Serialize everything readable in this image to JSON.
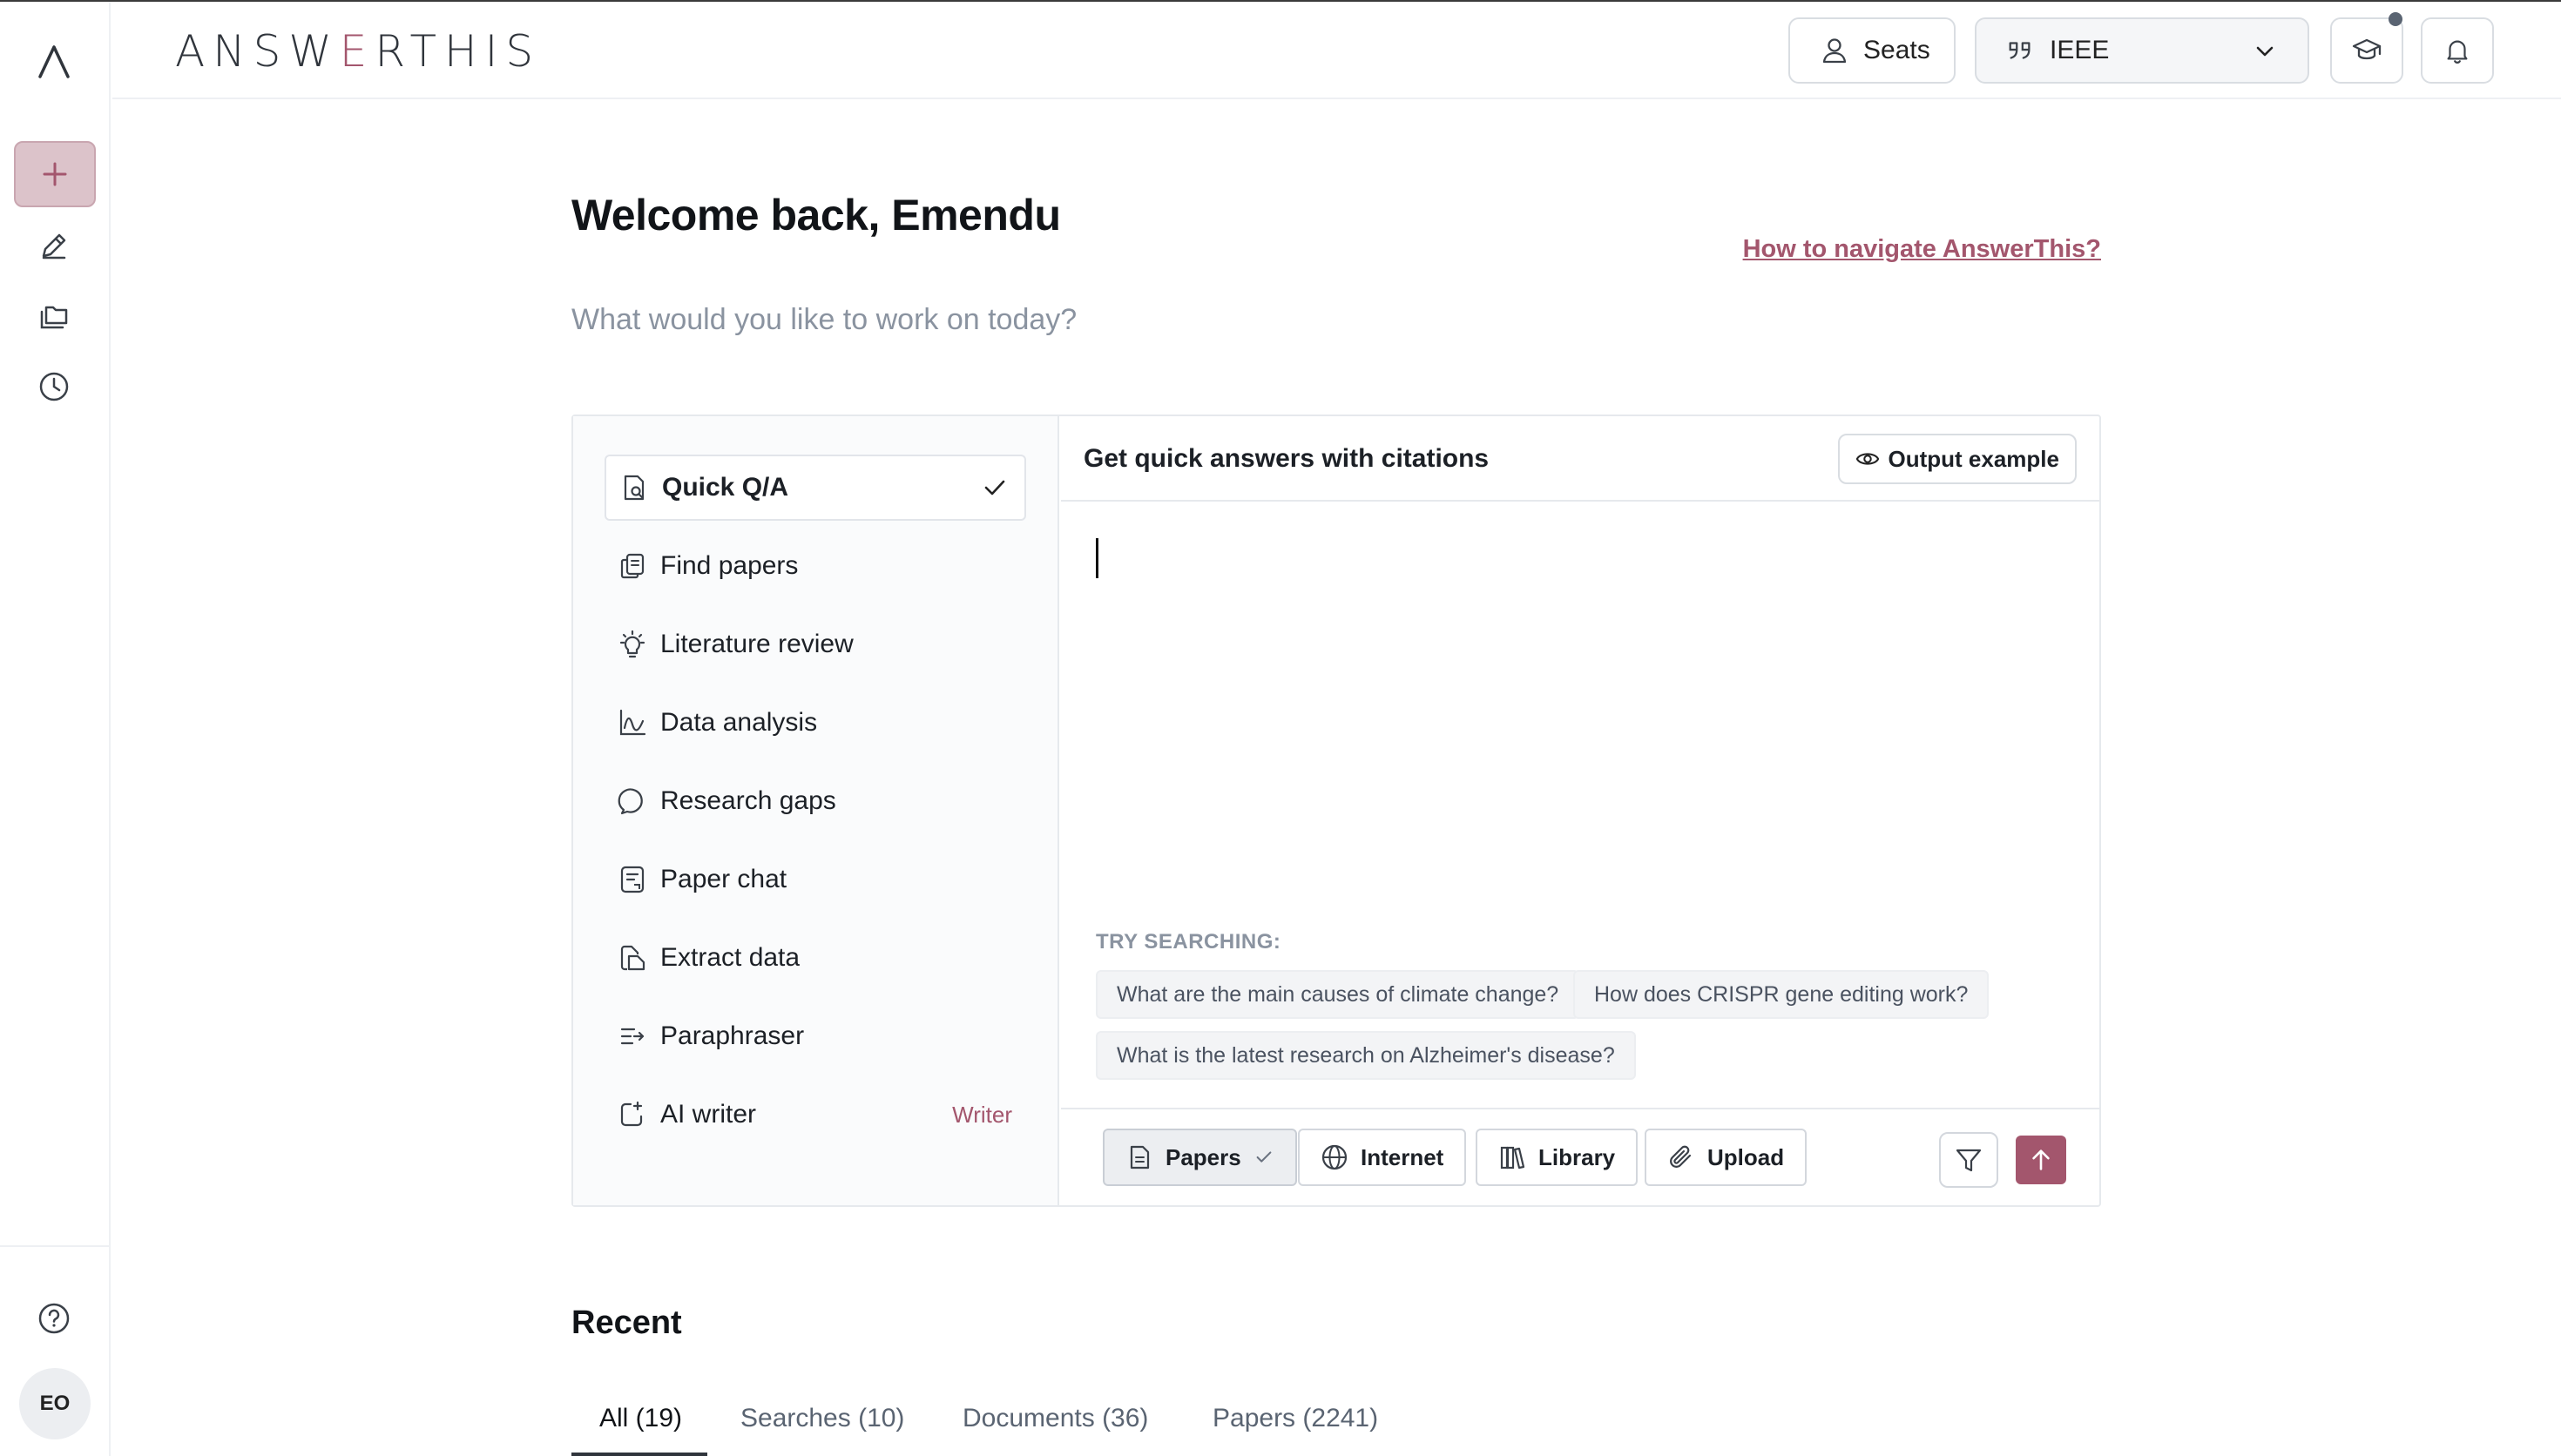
{
  "app": {
    "brand_prefix": "ANSW",
    "brand_accent": "E",
    "brand_suffix": "RTHIS",
    "accent_color": "#a3566d"
  },
  "header": {
    "seats_label": "Seats",
    "citation_style": "IEEE"
  },
  "rail": {
    "avatar_initials": "EO",
    "icons": [
      "logo-icon",
      "plus-icon",
      "pen-icon",
      "folders-icon",
      "clock-icon",
      "help-icon"
    ]
  },
  "welcome": {
    "title": "Welcome back, Emendu",
    "subtitle": "What would you like to work on today?",
    "help_link": "How to navigate AnswerThis?"
  },
  "menu": {
    "items": [
      {
        "label": "Quick Q/A",
        "icon": "quick-qa-icon",
        "active": true
      },
      {
        "label": "Find papers",
        "icon": "find-papers-icon"
      },
      {
        "label": "Literature review",
        "icon": "lightbulb-icon"
      },
      {
        "label": "Data analysis",
        "icon": "chart-icon"
      },
      {
        "label": "Research gaps",
        "icon": "speech-bubble-icon"
      },
      {
        "label": "Paper chat",
        "icon": "paper-chat-icon"
      },
      {
        "label": "Extract data",
        "icon": "extract-icon"
      },
      {
        "label": "Paraphraser",
        "icon": "paraphrase-icon"
      },
      {
        "label": "AI writer",
        "icon": "ai-writer-icon",
        "tag": "Writer"
      }
    ]
  },
  "panel": {
    "title": "Get quick answers with citations",
    "output_example": "Output example",
    "try_label": "TRY SEARCHING:",
    "suggestions": [
      "What are the main causes of climate change?",
      "How does CRISPR gene editing work?",
      "What is the latest research on Alzheimer's disease?"
    ],
    "sources": [
      "Papers",
      "Internet",
      "Library",
      "Upload"
    ]
  },
  "recent": {
    "title": "Recent",
    "tabs": [
      "All (19)",
      "Searches (10)",
      "Documents (36)",
      "Papers (2241)"
    ]
  }
}
